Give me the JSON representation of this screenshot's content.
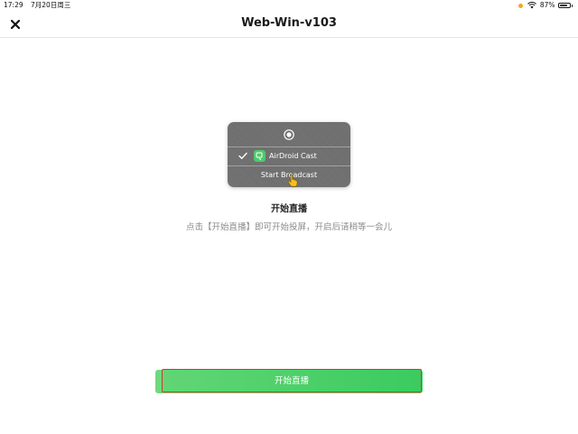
{
  "status_bar": {
    "time": "17:29",
    "date": "7月20日周三",
    "battery": "87%",
    "battery_level": 0.87
  },
  "nav": {
    "title": "Web-Win-v103",
    "close_icon": "close-icon"
  },
  "illustration": {
    "app_name": "AirDroid Cast",
    "broadcast_label": "Start Broadcast",
    "icons": [
      "record-icon",
      "checkmark-icon",
      "airdroid-cast-app-icon",
      "pointing-hand-icon"
    ]
  },
  "main": {
    "title": "开始直播",
    "description": "点击【开始直播】即可开始投屏，开启后请稍等一会儿"
  },
  "action": {
    "start_label": "开始直播"
  },
  "colors": {
    "button_green": "#4fd16e",
    "button_border": "#d23a2a",
    "status_dot": "#f5a623"
  }
}
